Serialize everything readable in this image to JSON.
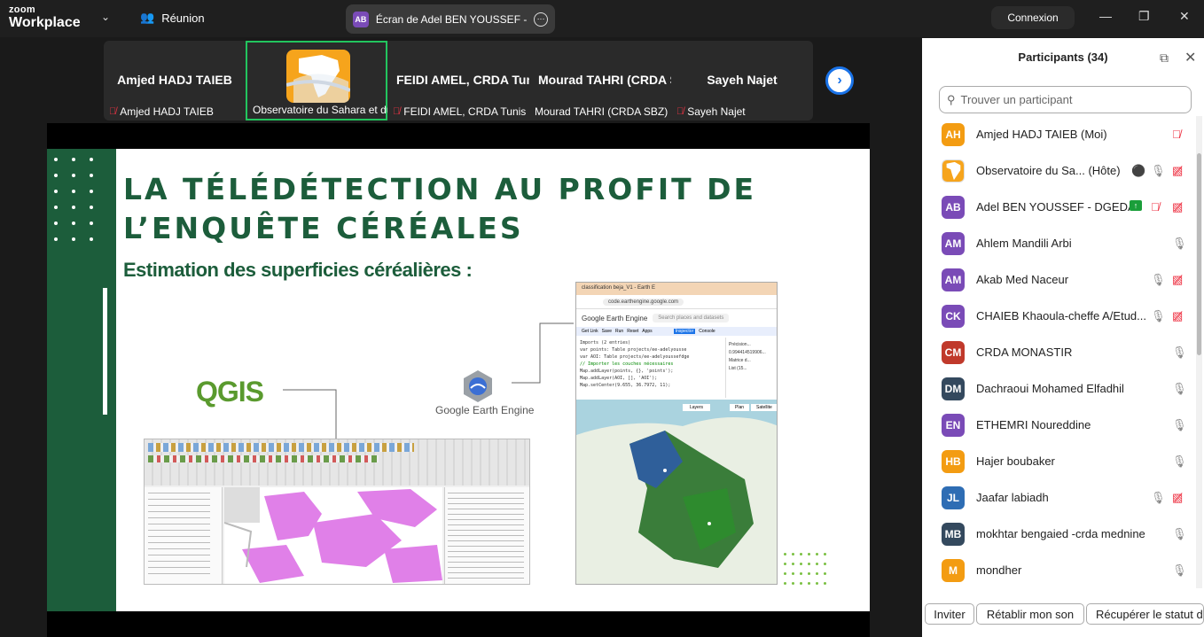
{
  "app": {
    "logo_line1": "zoom",
    "logo_line2": "Workplace"
  },
  "topbar": {
    "meeting_label": "Réunion",
    "share_avatar": "AB",
    "share_label": "Écran de Adel BEN YOUSSEF - DGEDA",
    "connexion_label": "Connexion"
  },
  "gallery": [
    {
      "big": "Amjed HADJ TAIEB",
      "name": "Amjed HADJ TAIEB",
      "muted": true
    },
    {
      "big": "",
      "name": "Observatoire du Sahara et du Sahel",
      "muted": false,
      "active": true
    },
    {
      "big": "FEIDI AMEL, CRDA Tunis",
      "name": "FEIDI AMEL, CRDA Tunis",
      "muted": true
    },
    {
      "big": "Mourad TAHRI (CRDA SBZ)",
      "name": "Mourad TAHRI (CRDA SBZ)",
      "muted": false
    },
    {
      "big": "Sayeh Najet",
      "name": "Sayeh Najet",
      "muted": true
    }
  ],
  "slide": {
    "title_line1": "LA TÉLÉDÉTECTION AU PROFIT DE",
    "title_line2": "L’ENQUÊTE CÉRÉALES",
    "subtitle": "Estimation des superficies céréalières :",
    "qgis_label": "QGIS",
    "gee_label": "Google Earth Engine",
    "gee_window": {
      "tab": "classification beja_V1 - Earth E",
      "url": "code.earthengine.google.com",
      "brand": "Google Earth Engine",
      "search_placeholder": "Search places and datasets",
      "buttons": [
        "Get Link",
        "Save",
        "Run",
        "Reset",
        "Apps"
      ],
      "panel_tabs": [
        "Inspector",
        "Console"
      ],
      "code": [
        "Imports (2 entries)",
        "var points: Table projects/ee-adelyousse",
        "var AOI: Table projects/ee-adelyoussefdge",
        "// Importer les couches nécessaires",
        "Map.addLayer(points, {}, 'points');",
        "Map.addLayer(AOI, [], 'AOI');",
        "Map.setCenter(9.655, 36.7972, 11);"
      ],
      "console": [
        "Précision...",
        "0.994414519906...",
        "Matrice d...",
        "List (15..."
      ],
      "map_buttons": [
        "Layers",
        "Plan",
        "Satellite"
      ]
    }
  },
  "participants": {
    "title": "Participants (34)",
    "search_placeholder": "Trouver un participant",
    "list": [
      {
        "initials": "AH",
        "name": "Amjed HADJ TAIEB (Moi)",
        "color": "#f39c12",
        "icons": [
          "mic-off"
        ]
      },
      {
        "initials": "",
        "name": "Observatoire du Sa...  (Hôte)",
        "color": "#ffffff",
        "icons": [
          "record",
          "mic",
          "video-off"
        ]
      },
      {
        "initials": "AB",
        "name": "Adel BEN YOUSSEF - DGEDA",
        "color": "#7a4bb7",
        "icons": [
          "share",
          "mic-off",
          "video-off"
        ]
      },
      {
        "initials": "AM",
        "name": "Ahlem Mandili Arbi",
        "color": "#7a4bb7",
        "icons": [
          "mic"
        ]
      },
      {
        "initials": "AM",
        "name": "Akab Med Naceur",
        "color": "#7a4bb7",
        "icons": [
          "mic",
          "video-off"
        ]
      },
      {
        "initials": "CK",
        "name": "CHAIEB Khaoula-cheffe A/Etud...",
        "color": "#7a4bb7",
        "icons": [
          "mic",
          "video-off"
        ]
      },
      {
        "initials": "CM",
        "name": "CRDA MONASTIR",
        "color": "#c0392b",
        "icons": [
          "mic"
        ]
      },
      {
        "initials": "DM",
        "name": "Dachraoui Mohamed Elfadhil",
        "color": "#34495e",
        "icons": [
          "mic"
        ]
      },
      {
        "initials": "EN",
        "name": "ETHEMRI Noureddine",
        "color": "#7a4bb7",
        "icons": [
          "mic"
        ]
      },
      {
        "initials": "HB",
        "name": "Hajer boubaker",
        "color": "#f39c12",
        "icons": [
          "mic"
        ]
      },
      {
        "initials": "JL",
        "name": "Jaafar labiadh",
        "color": "#2e6db4",
        "icons": [
          "mic",
          "video-off"
        ]
      },
      {
        "initials": "MB",
        "name": "mokhtar bengaied -crda mednine",
        "color": "#34495e",
        "icons": [
          "mic"
        ]
      },
      {
        "initials": "M",
        "name": "mondher",
        "color": "#f39c12",
        "icons": [
          "mic"
        ]
      }
    ],
    "buttons": [
      "Inviter",
      "Rétablir mon son",
      "Récupérer le statut d"
    ]
  }
}
